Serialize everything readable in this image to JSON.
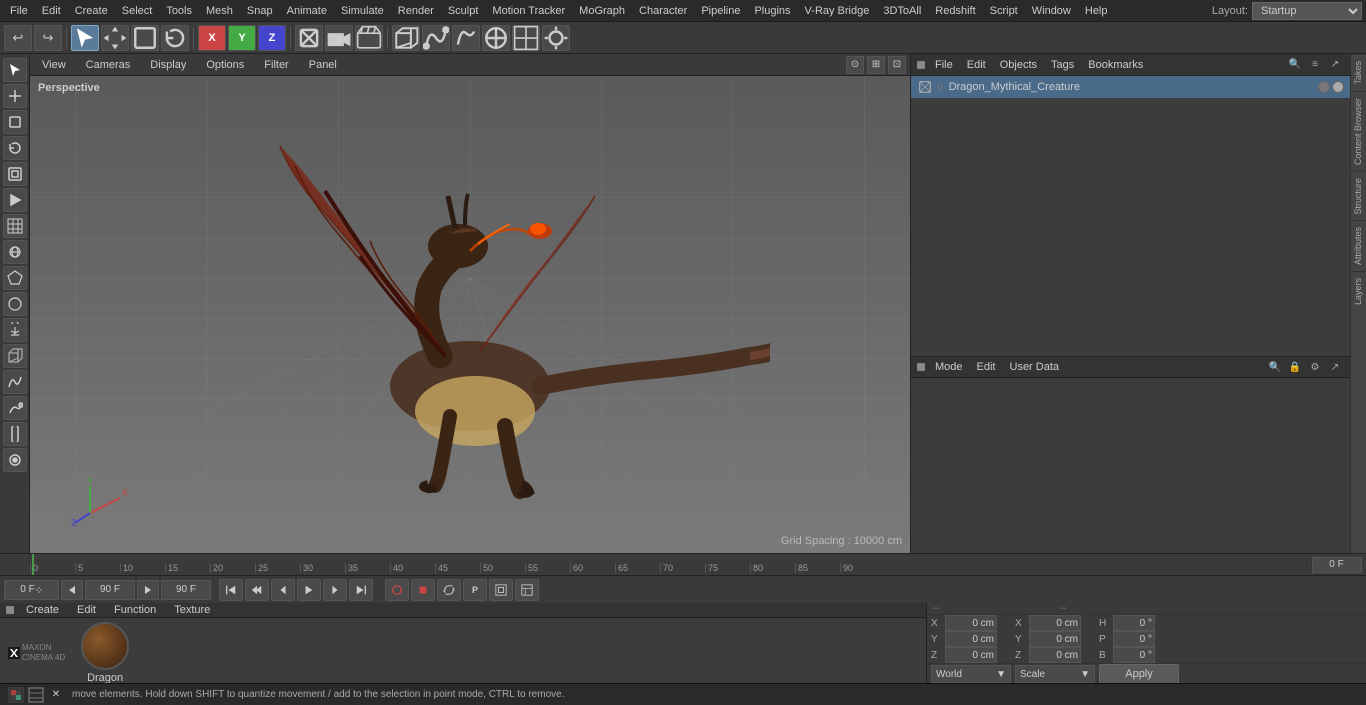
{
  "menuBar": {
    "items": [
      "File",
      "Edit",
      "Create",
      "Select",
      "Tools",
      "Mesh",
      "Snap",
      "Animate",
      "Simulate",
      "Render",
      "Sculpt",
      "Motion Tracker",
      "MoGraph",
      "Character",
      "Pipeline",
      "Plugins",
      "V-Ray Bridge",
      "3DToAll",
      "Redshift",
      "Script",
      "Window",
      "Help"
    ],
    "layout_label": "Layout:",
    "layout_value": "Startup"
  },
  "toolbar": {
    "undo_label": "↩",
    "redo_label": "↪",
    "select_label": "↖",
    "move_label": "✛",
    "scale_label": "⊞",
    "rotate_label": "↺",
    "axis_x": "X",
    "axis_y": "Y",
    "axis_z": "Z",
    "frame_label": "▣",
    "play_label": "▷",
    "record_label": "⏺"
  },
  "viewport": {
    "label": "Perspective",
    "grid_spacing": "Grid Spacing : 10000 cm",
    "tabs": [
      "View",
      "Cameras",
      "Display",
      "Options",
      "Filter",
      "Panel"
    ]
  },
  "objectManager": {
    "menu_items": [
      "File",
      "Edit",
      "Objects",
      "Tags",
      "Bookmarks"
    ],
    "objects": [
      {
        "name": "Dragon_Mythical_Creature",
        "icon": "▣",
        "dots": [
          "gray",
          "colored"
        ]
      }
    ]
  },
  "attributeManager": {
    "menu_items": [
      "Mode",
      "Edit",
      "User Data"
    ]
  },
  "timeline": {
    "marks": [
      "0",
      "5",
      "10",
      "15",
      "20",
      "25",
      "30",
      "35",
      "40",
      "45",
      "50",
      "55",
      "60",
      "65",
      "70",
      "75",
      "80",
      "85",
      "90"
    ],
    "frame_display": "0 F",
    "start_frame": "0 F",
    "end_frame_1": "90 F",
    "end_frame_2": "90 F"
  },
  "playback": {
    "buttons": [
      "⏮",
      "◀◀",
      "◀",
      "▶",
      "▶▶",
      "⏭"
    ],
    "play_btn_index": 3,
    "extra_btns": [
      "⊞",
      "⊟",
      "↺",
      "P",
      "⊞⊞",
      "▣"
    ]
  },
  "material": {
    "menu_items": [
      "Create",
      "Edit",
      "Function",
      "Texture"
    ],
    "name": "Dragon",
    "thumbnail_color1": "#8a5a2a",
    "thumbnail_color2": "#3a2010"
  },
  "coordinates": {
    "x_pos": "0 cm",
    "y_pos": "0 cm",
    "z_pos": "0 cm",
    "x_size": "0 cm",
    "y_size": "0 cm",
    "z_size": "0 cm",
    "p_rot": "0 °",
    "h_rot": "0 °",
    "b_rot": "0 °",
    "dash1": "--",
    "dash2": "--",
    "world_label": "World",
    "scale_label": "Scale",
    "apply_label": "Apply"
  },
  "statusBar": {
    "text": "move elements. Hold down SHIFT to quantize movement / add to the selection in point mode, CTRL to remove.",
    "icons": [
      "🎬",
      "⊞",
      "✕"
    ]
  },
  "rightTabs": [
    "Takes",
    "Content Browser",
    "Structure",
    "Attributes",
    "Layers"
  ],
  "leftButtons": [
    "↖",
    "✛",
    "⊞",
    "↺",
    "▣",
    "▷",
    "⊡",
    "⊠",
    "⊟",
    "⟲",
    "☰",
    "◈",
    "⊕",
    "S",
    "⚙",
    "⊗"
  ]
}
